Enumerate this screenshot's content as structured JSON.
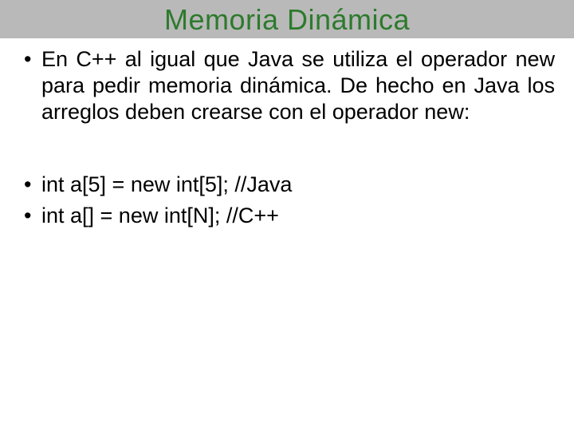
{
  "title": "Memoria Dinámica",
  "bullets": {
    "p1": "En C++ al igual que Java se utiliza el operador new para pedir memoria dinámica. De hecho en Java los arreglos deben crearse con el operador new:",
    "p2": "int a[5] = new int[5]; //Java",
    "p3": "int a[] = new int[N]; //C++"
  }
}
